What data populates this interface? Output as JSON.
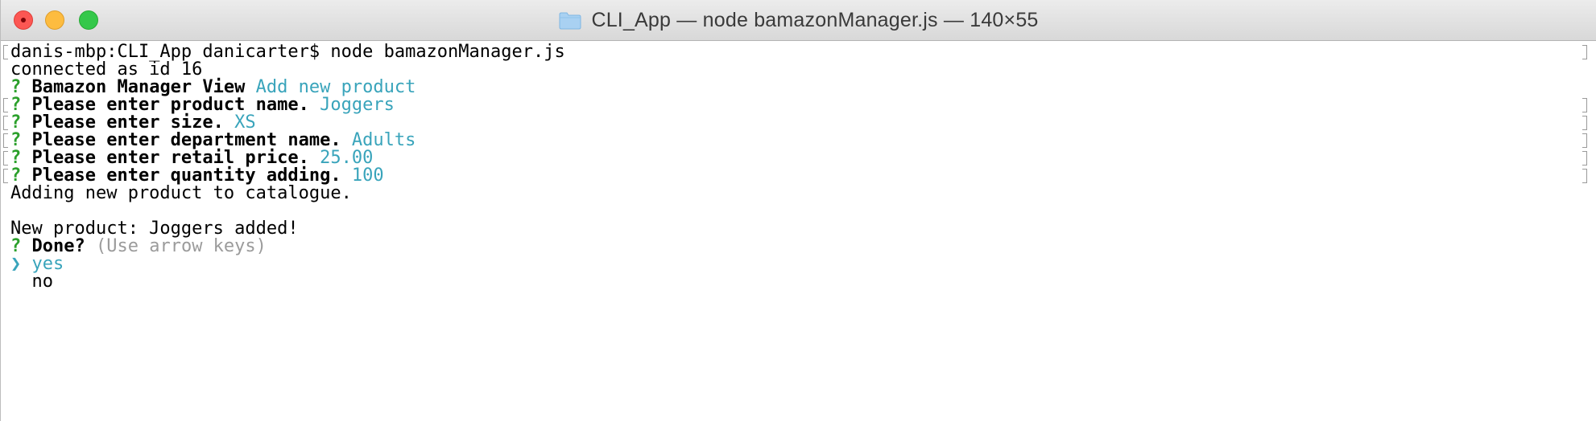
{
  "window": {
    "title": "CLI_App — node bamazonManager.js — 140×55",
    "folder_icon": "folder-icon",
    "colors": {
      "close": "#fc5753",
      "minimize": "#fdbc40",
      "maximize": "#34c84a",
      "question_mark": "#2ca02c",
      "answer": "#39a4bb",
      "hint": "#9b9b9b"
    }
  },
  "terminal": {
    "command_line": "danis-mbp:CLI_App danicarter$ node bamazonManager.js",
    "connected": "connected as id 16",
    "q_mark": "?",
    "view_prompt": "Bamazon Manager View",
    "view_answer": "Add new product",
    "name_prompt": "Please enter product name.",
    "name_answer": "Joggers",
    "size_prompt": "Please enter size.",
    "size_answer": "XS",
    "dept_prompt": "Please enter department name.",
    "dept_answer": "Adults",
    "price_prompt": "Please enter retail price.",
    "price_answer": "25.00",
    "qty_prompt": "Please enter quantity adding.",
    "qty_answer": "100",
    "adding_msg": "Adding new product to catalogue.",
    "added_msg": "New product: Joggers added!",
    "done_prompt": "Done?",
    "done_hint": "(Use arrow keys)",
    "pointer": "❯",
    "option_yes": "yes",
    "option_no": "no"
  }
}
